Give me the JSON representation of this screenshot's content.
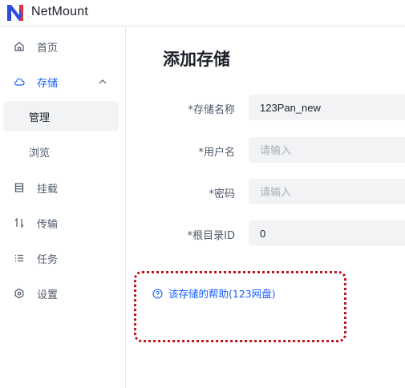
{
  "app": {
    "name": "NetMount",
    "accent": "#165dff",
    "logo_colors": [
      "#2f4bdf",
      "#e5323f"
    ]
  },
  "sidebar": {
    "items": [
      {
        "key": "home",
        "icon": "home-icon",
        "label": "首页"
      },
      {
        "key": "storage",
        "icon": "cloud-icon",
        "label": "存储",
        "expanded": true,
        "children": [
          {
            "label": "管理",
            "selected": true
          },
          {
            "label": "浏览"
          }
        ]
      },
      {
        "key": "mount",
        "icon": "mount-icon",
        "label": "挂载"
      },
      {
        "key": "transfer",
        "icon": "transfer-icon",
        "label": "传输"
      },
      {
        "key": "tasks",
        "icon": "list-icon",
        "label": "任务"
      },
      {
        "key": "settings",
        "icon": "gear-icon",
        "label": "设置"
      }
    ]
  },
  "main": {
    "title": "添加存储",
    "form": {
      "storage_name": {
        "label": "*存储名称",
        "value": "123Pan_new",
        "placeholder": ""
      },
      "username": {
        "label": "*用户名",
        "value": "",
        "placeholder": "请输入"
      },
      "password": {
        "label": "*密码",
        "value": "",
        "placeholder": "请输入"
      },
      "root_id": {
        "label": "*根目录ID",
        "value": "0",
        "placeholder": ""
      }
    },
    "help_link": "该存储的帮助(123网盘)",
    "highlight_color": "#c0121f"
  }
}
